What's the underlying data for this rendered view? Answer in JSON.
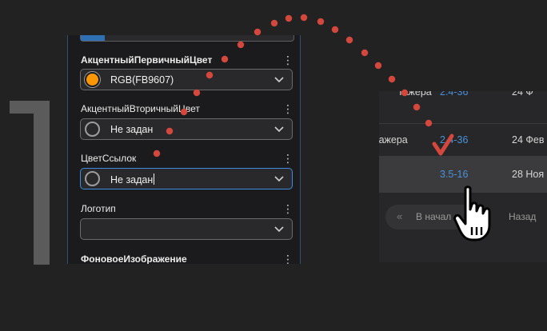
{
  "panel": {
    "properties": [
      {
        "label": "АкцентныйПервичныйЦвет",
        "value": "RGB(FB9607)",
        "swatch": "#FB9607"
      },
      {
        "label": "АкцентныйВторичныйЦвет",
        "value": "Не задан"
      },
      {
        "label": "ЦветСсылок",
        "value": "Не задан"
      },
      {
        "label": "Логотип",
        "value": ""
      },
      {
        "label": "ФоновоеИзображение"
      }
    ]
  },
  "table": {
    "rows": [
      {
        "col1": "тажера",
        "col2": "2.4-36",
        "col3": "24 Фев"
      },
      {
        "col1": "",
        "col2": "3.5-16",
        "col3": "28 Ноя"
      }
    ]
  },
  "pager": {
    "first_label": "В начал",
    "back_label": "Назад",
    "first_icon": "double-chevron-left-icon"
  },
  "colors": {
    "accent_orange": "#FB9607",
    "link_blue": "#4a90d9",
    "dotted_arrow": "#d4473c",
    "focus_blue": "#3d8be0"
  }
}
